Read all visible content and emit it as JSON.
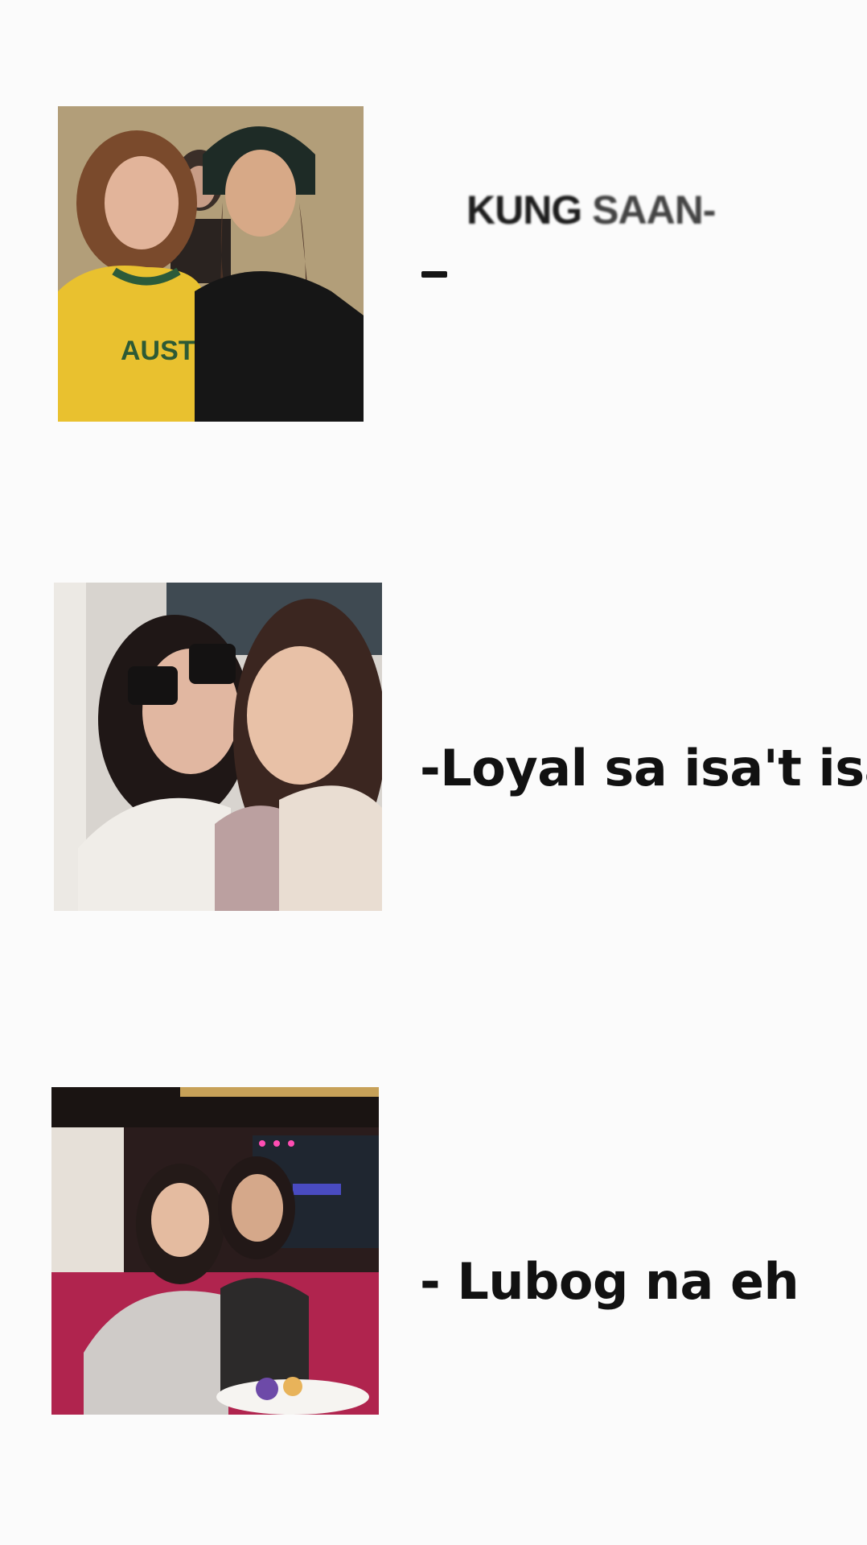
{
  "header": {
    "word1": "KUNG",
    "word2": "SAAN-"
  },
  "rows": [
    {
      "caption": "-"
    },
    {
      "caption": "-Loyal sa isa't isa"
    },
    {
      "caption": "- Lubog na eh"
    }
  ],
  "photos": [
    {
      "jersey_text": "AUSTRALI"
    }
  ]
}
